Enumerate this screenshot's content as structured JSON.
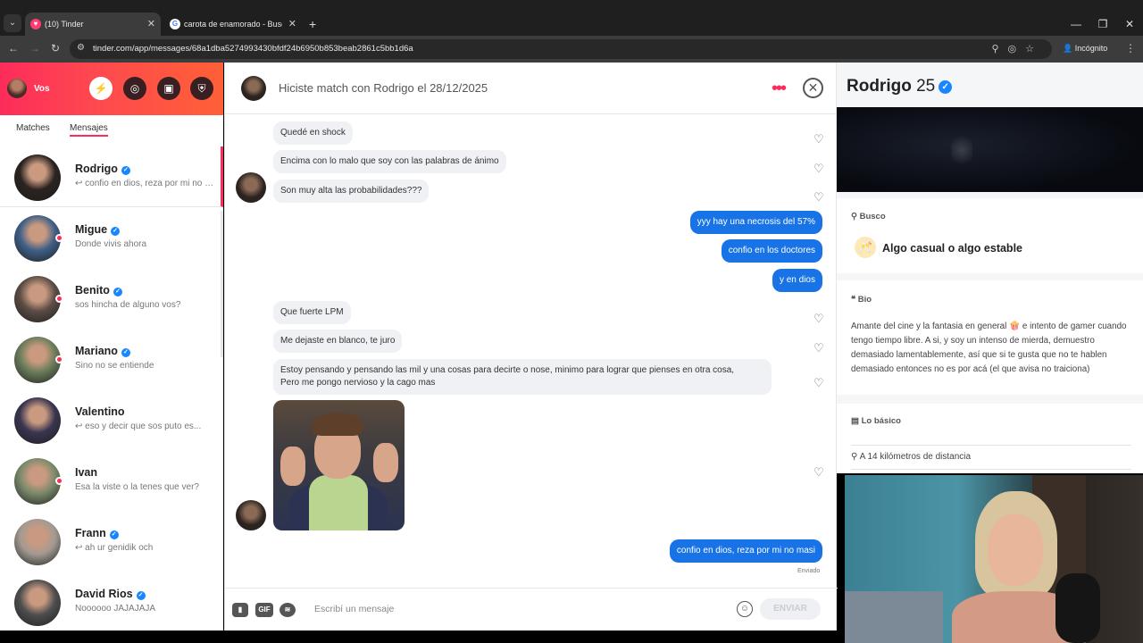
{
  "browser": {
    "tabs": [
      {
        "title": "(10) Tinder",
        "active": true
      },
      {
        "title": "carota de enamorado - Buscar con",
        "active": false
      }
    ],
    "url": "tinder.com/app/messages/68a1dba5274993430bfdf24b6950b853beab2861c5bb1d6a",
    "incognito_label": "Incógnito"
  },
  "sidebar": {
    "me_label": "Vos",
    "tabs": [
      "Matches",
      "Mensajes"
    ],
    "active_tab": "Mensajes",
    "conversations": [
      {
        "name": "Rodrigo",
        "preview": "↩ confio en dios, reza por mi no masi",
        "verified": true,
        "online": false,
        "active": true,
        "avatar_color": "#2a2320"
      },
      {
        "name": "Migue",
        "preview": "Donde vivis ahora",
        "verified": true,
        "online": true,
        "active": false,
        "avatar_color": "#3f5f86"
      },
      {
        "name": "Benito",
        "preview": "sos hincha de alguno vos?",
        "verified": true,
        "online": true,
        "active": false,
        "avatar_color": "#5b4c45"
      },
      {
        "name": "Mariano",
        "preview": "Sino no se entiende",
        "verified": true,
        "online": true,
        "active": false,
        "avatar_color": "#6b7d5a"
      },
      {
        "name": "Valentino",
        "preview": "↩ eso y decir que sos puto es...",
        "verified": false,
        "online": false,
        "active": false,
        "avatar_color": "#3a3550"
      },
      {
        "name": "Ivan",
        "preview": "Esa la viste o la tenes que ver?",
        "verified": false,
        "online": true,
        "active": false,
        "avatar_color": "#7a8a6b"
      },
      {
        "name": "Frann",
        "preview": "↩ ah ur genidik och",
        "verified": true,
        "online": false,
        "active": false,
        "avatar_color": "#a39a92"
      },
      {
        "name": "David Rios",
        "preview": "Noooooo JAJAJAJA",
        "verified": true,
        "online": false,
        "active": false,
        "avatar_color": "#4e4e4e"
      }
    ]
  },
  "chat": {
    "header_title": "Hiciste match con Rodrigo el 28/12/2025",
    "messages": [
      {
        "dir": "in",
        "text": "Quedé en shock"
      },
      {
        "dir": "in",
        "text": "Encima con lo malo que soy con las palabras de ánimo"
      },
      {
        "dir": "in",
        "text": "Son muy alta las probabilidades???"
      },
      {
        "dir": "out",
        "text": "yyy hay una necrosis del 57%"
      },
      {
        "dir": "out",
        "text": "confio en los doctores"
      },
      {
        "dir": "out",
        "text": "y en dios"
      },
      {
        "dir": "in",
        "text": "Que fuerte LPM"
      },
      {
        "dir": "in",
        "text": "Me dejaste en blanco, te juro"
      },
      {
        "dir": "in",
        "text": "Estoy pensando y pensando las mil y una cosas para decirte o nose, minimo para lograr que pienses en otra cosa,\nPero me pongo nervioso y la cago mas"
      },
      {
        "dir": "in",
        "text": "",
        "kind": "gif"
      },
      {
        "dir": "out",
        "text": "confio en dios, reza por mi no masi"
      }
    ],
    "sent_status": "Enviado",
    "composer": {
      "placeholder": "Escribí un mensaje",
      "gif_label": "GIF",
      "send_label": "ENVIAR"
    }
  },
  "profile": {
    "name": "Rodrigo",
    "age": "25",
    "busco_label": "Busco",
    "busco_value": "Algo casual o algo estable",
    "bio_label": "Bio",
    "bio_text": "Amante del cine y la fantasia en general 🍿 e intento de gamer cuando tengo tiempo libre. A si, y soy un intenso de mierda, demuestro demasiado lamentablemente, así que si te gusta que no te hablen demasiado entonces no es por acá (el que avisa no traiciona)",
    "basics_label": "Lo básico",
    "distance": "A 14 kilómetros de distancia"
  },
  "colors": {
    "brand_pink": "#fd2c5b",
    "out_bubble": "#1873e6",
    "in_bubble": "#f0f1f4",
    "verified": "#1786ff"
  }
}
